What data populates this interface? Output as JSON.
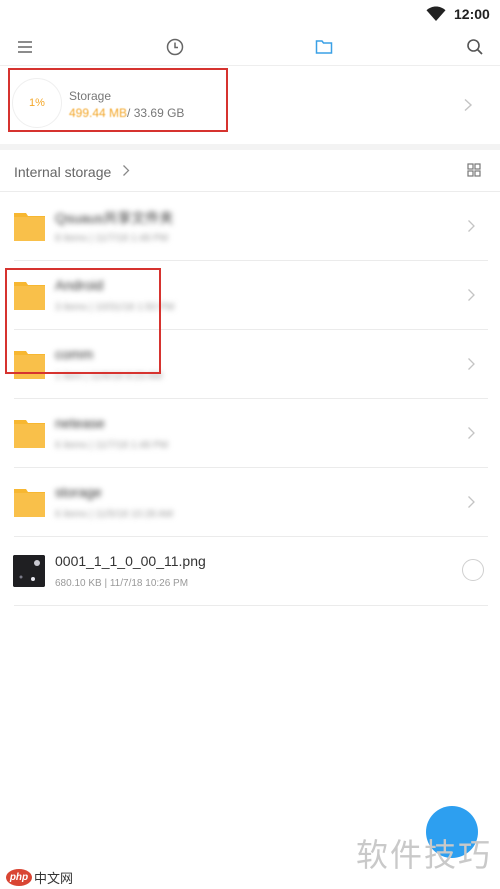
{
  "status_bar": {
    "time": "12:00"
  },
  "toolbar": {
    "menu_icon": "menu-icon",
    "recent_icon": "clock-icon",
    "files_icon": "folder-outline-icon",
    "search_icon": "search-icon",
    "active_color": "#3aa0e6"
  },
  "storage": {
    "percent_label": "1%",
    "percent": 1,
    "title": "Storage",
    "used": "499.44 MB",
    "total": "/ 33.69 GB",
    "accent_color": "#f3a72a"
  },
  "breadcrumb": {
    "label": "Internal storage"
  },
  "items": [
    {
      "name": "Qsuaus共享文件夹",
      "meta": "8 items | 11/7/18 1:48 PM",
      "kind": "folder"
    },
    {
      "name": "Android",
      "meta": "3 items | 10/31/18 1:50 PM",
      "kind": "folder"
    },
    {
      "name": "comm",
      "meta": "1 item | 11/6/18 8:23 AM",
      "kind": "folder"
    },
    {
      "name": "netease",
      "meta": "6 items | 11/7/18 1:48 PM",
      "kind": "folder"
    },
    {
      "name": "storage",
      "meta": "6 items | 11/5/18 10:28 AM",
      "kind": "folder"
    },
    {
      "name": "0001_1_1_0_00_11.png",
      "meta": "680.10 KB | 11/7/18 10:26 PM",
      "kind": "image"
    }
  ],
  "fab": {
    "color": "#2d9ff0"
  },
  "watermark": {
    "cn": "软件技巧",
    "site": "中文网",
    "logo": "php"
  }
}
